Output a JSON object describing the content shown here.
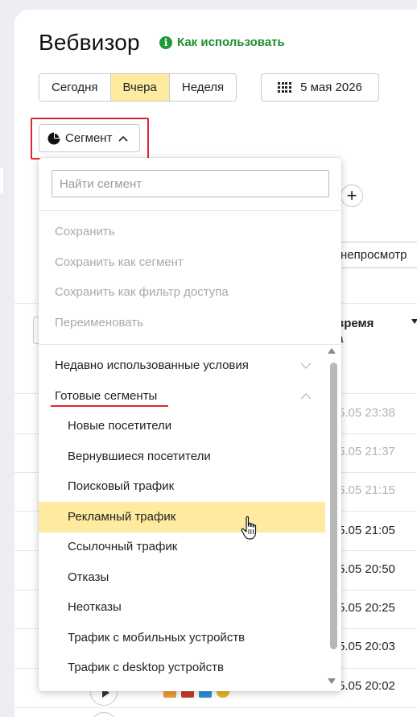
{
  "page": {
    "title": "Вебвизор",
    "help_link": "Как использовать"
  },
  "period": {
    "options": [
      "Сегодня",
      "Вчера",
      "Неделя"
    ],
    "selected": "Вчера"
  },
  "date_picker": {
    "label": "5 мая 2026"
  },
  "segment_button": {
    "label": "Сегмент"
  },
  "toolbar": {
    "plus": "+",
    "unviewed_label": "ь непросмотр"
  },
  "table": {
    "time_column": [
      "время",
      "а"
    ],
    "rows": [
      {
        "time": "5.05 23:38",
        "viewed": true
      },
      {
        "time": "5.05 21:37",
        "viewed": true
      },
      {
        "time": "5.05 21:15",
        "viewed": true
      },
      {
        "time": "5.05 21:05",
        "viewed": false
      },
      {
        "time": "5.05 20:50",
        "viewed": false
      },
      {
        "time": "5.05 20:25",
        "viewed": false
      },
      {
        "time": "5.05 20:03",
        "viewed": false
      },
      {
        "time": "5.05 20:02",
        "viewed": false
      }
    ]
  },
  "dropdown": {
    "search_placeholder": "Найти сегмент",
    "actions": [
      "Сохранить",
      "Сохранить как сегмент",
      "Сохранить как фильтр доступа",
      "Переименовать"
    ],
    "groups": {
      "recent": "Недавно использованные условия",
      "ready": "Готовые сегменты"
    },
    "ready_segments": [
      "Новые посетители",
      "Вернувшиеся посетители",
      "Поисковый трафик",
      "Рекламный трафик",
      "Ссылочный трафик",
      "Отказы",
      "Неотказы",
      "Трафик с мобильных устройств",
      "Трафик с desktop устройств"
    ],
    "hovered_segment": "Рекламный трафик"
  },
  "colors": {
    "accent_yellow": "#ffeba0",
    "highlight_red": "#e0262c",
    "link_green": "#1c8f2f"
  }
}
